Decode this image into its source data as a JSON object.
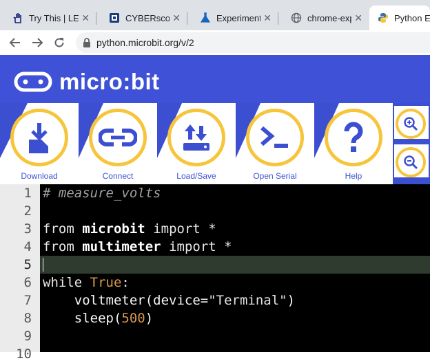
{
  "browser": {
    "tabs": [
      {
        "label": "Try This | LEA",
        "icon": "hand-icon"
      },
      {
        "label": "CYBERscope",
        "icon": "cyberscope-icon"
      },
      {
        "label": "Experiments",
        "icon": "flask-icon"
      },
      {
        "label": "chrome-expe",
        "icon": "globe-icon"
      },
      {
        "label": "Python Ed",
        "icon": "python-icon"
      }
    ],
    "url": "python.microbit.org/v/2"
  },
  "header": {
    "logo_text": "micro:bit"
  },
  "toolbar": {
    "buttons": [
      {
        "label": "Download",
        "icon": "download-icon"
      },
      {
        "label": "Connect",
        "icon": "connect-icon"
      },
      {
        "label": "Load/Save",
        "icon": "load-save-icon"
      },
      {
        "label": "Open Serial",
        "icon": "serial-terminal-icon"
      },
      {
        "label": "Help",
        "icon": "help-icon"
      }
    ],
    "zoom_in": "zoom-in-icon",
    "zoom_out": "zoom-out-icon"
  },
  "editor": {
    "current_line": 5,
    "lines": [
      {
        "num": "1",
        "text": "# measure_volts"
      },
      {
        "num": "2",
        "text": ""
      },
      {
        "num": "3",
        "t1": "from",
        "t2": "microbit",
        "t3": "import",
        "t4": "*"
      },
      {
        "num": "4",
        "t1": "from",
        "t2": "multimeter",
        "t3": "import",
        "t4": "*"
      },
      {
        "num": "5",
        "text": ""
      },
      {
        "num": "6",
        "t1": "while",
        "t2": "True",
        "t3": ":"
      },
      {
        "num": "7",
        "t1": "voltmeter(device=",
        "t2": "\"Terminal\"",
        "t3": ")"
      },
      {
        "num": "8",
        "t1": "sleep(",
        "t2": "500",
        "t3": ")"
      },
      {
        "num": "9",
        "text": ""
      },
      {
        "num": "10",
        "text": ""
      }
    ]
  },
  "colors": {
    "header_blue": "#3f51d6",
    "accent_yellow": "#f7c53b"
  }
}
